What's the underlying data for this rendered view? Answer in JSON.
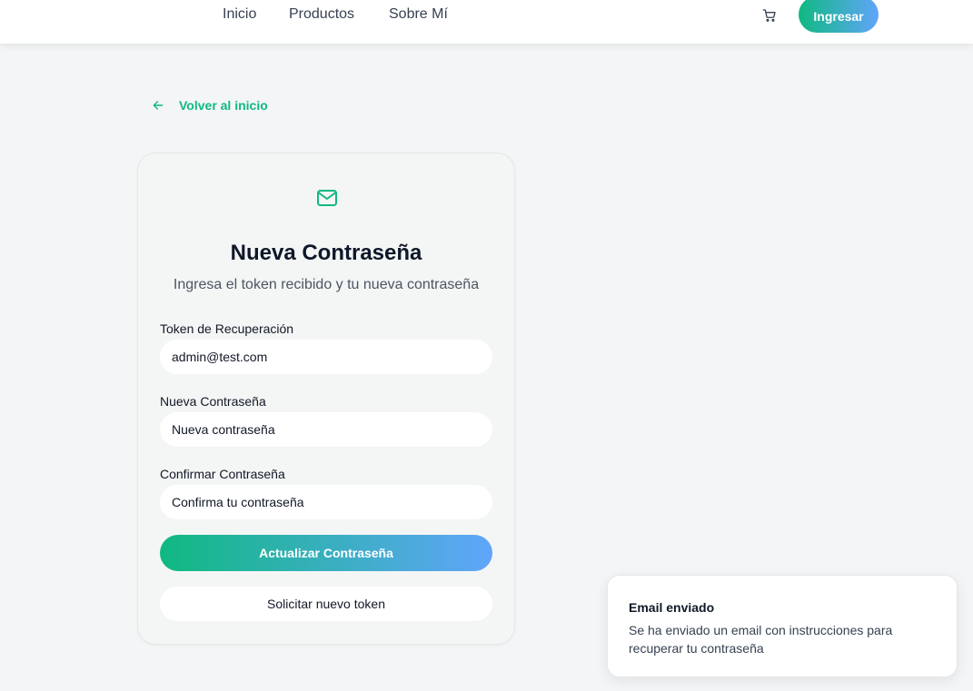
{
  "nav": {
    "links": [
      "Inicio",
      "Productos",
      "Sobre Mí"
    ],
    "cart_icon": "cart-icon",
    "login_label": "Ingresar"
  },
  "back": {
    "icon": "arrow-left-icon",
    "label": "Volver al inicio"
  },
  "card": {
    "icon": "mail-icon",
    "title": "Nueva Contraseña",
    "subtitle": "Ingresa el token recibido y tu nueva contraseña",
    "fields": [
      {
        "label": "Token de Recuperación",
        "value": "admin@test.com",
        "placeholder": ""
      },
      {
        "label": "Nueva Contraseña",
        "value": "",
        "placeholder": "Nueva contraseña"
      },
      {
        "label": "Confirmar Contraseña",
        "value": "",
        "placeholder": "Confirma tu contraseña"
      }
    ],
    "submit_label": "Actualizar Contraseña",
    "request_token_label": "Solicitar nuevo token"
  },
  "toast": {
    "title": "Email enviado",
    "message": "Se ha enviado un email con instrucciones para recuperar tu contraseña"
  },
  "colors": {
    "accent": "#10b981",
    "gradient_end": "#60a5fa",
    "background": "#f3f5f6"
  }
}
